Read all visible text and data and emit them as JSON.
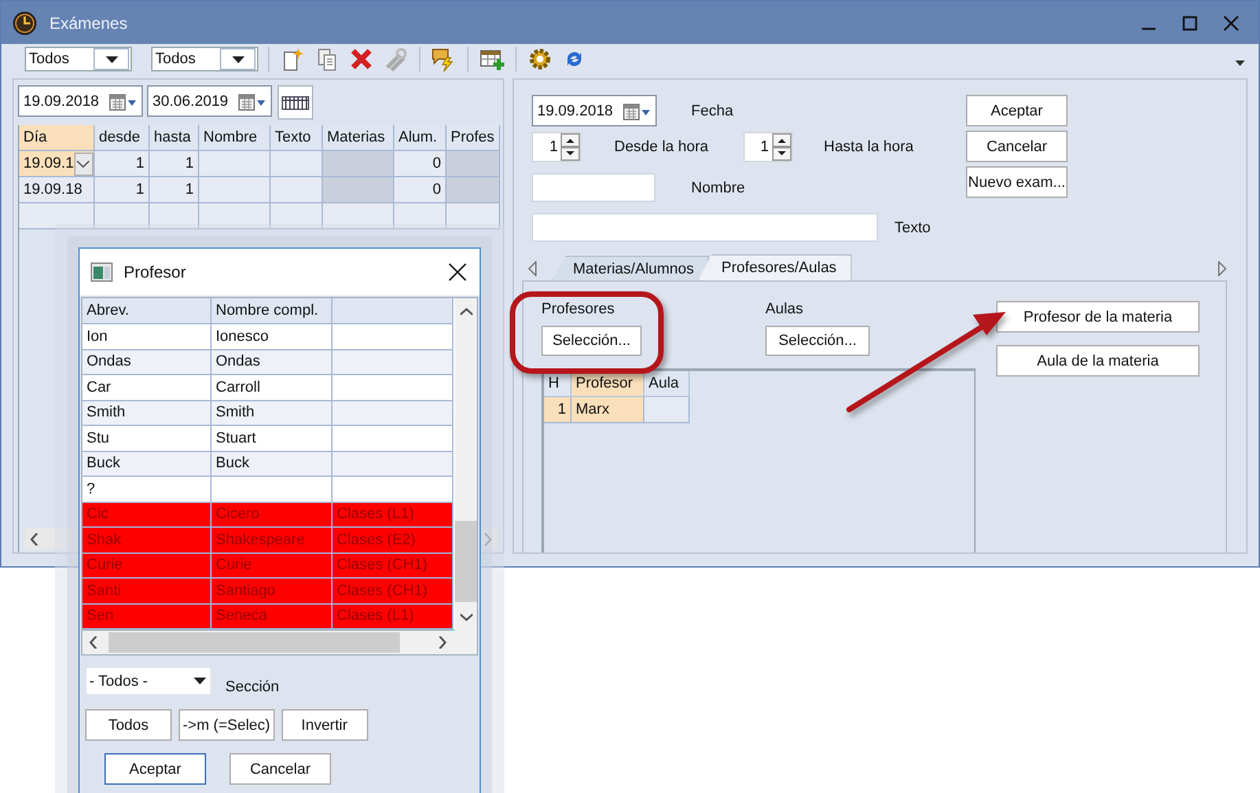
{
  "window": {
    "title": "Exámenes"
  },
  "toolbar": {
    "filters": [
      {
        "value": "Todos"
      },
      {
        "value": "Todos"
      }
    ]
  },
  "left_pane": {
    "date_from": "19.09.2018",
    "date_to": "30.06.2019",
    "table": {
      "columns": [
        {
          "label": "Día",
          "current": true,
          "readonly": false
        },
        {
          "label": "desde",
          "current": false,
          "readonly": false
        },
        {
          "label": "hasta",
          "current": false,
          "readonly": false
        },
        {
          "label": "Nombre",
          "current": false,
          "readonly": false
        },
        {
          "label": "Texto",
          "current": false,
          "readonly": false
        },
        {
          "label": "Materias",
          "current": false,
          "readonly": true
        },
        {
          "label": "Alum.",
          "current": false,
          "readonly": false
        },
        {
          "label": "Profes",
          "current": false,
          "readonly": true
        }
      ],
      "rows": [
        {
          "selected": true,
          "cells": [
            "19.09.1",
            "1",
            "1",
            null,
            null,
            null,
            "0",
            null
          ]
        },
        {
          "selected": false,
          "cells": [
            "19.09.18",
            "1",
            "1",
            null,
            null,
            null,
            "0",
            null
          ]
        }
      ]
    }
  },
  "form": {
    "date": {
      "value": "19.09.2018",
      "label": "Fecha"
    },
    "from_hour": {
      "value": "1",
      "label": "Desde la hora"
    },
    "to_hour": {
      "value": "1",
      "label": "Hasta la hora"
    },
    "name": {
      "label": "Nombre"
    },
    "text": {
      "label": "Texto"
    },
    "buttons": [
      "Aceptar",
      "Cancelar",
      "Nuevo exam..."
    ]
  },
  "tabs": [
    {
      "label": "Materias/Alumnos",
      "selected": false
    },
    {
      "label": "Profesores/Aulas",
      "selected": true
    }
  ],
  "tab_panel": {
    "teachers_label": "Profesores",
    "teachers_button": "Selección...",
    "rooms_label": "Aulas",
    "rooms_button": "Selección...",
    "side_buttons": [
      "Profesor de la materia",
      "Aula de la materia"
    ],
    "table": {
      "columns": [
        {
          "label": "H",
          "current": false
        },
        {
          "label": "Profesor",
          "current": true
        },
        {
          "label": "Aula",
          "current": false
        }
      ],
      "rows": [
        {
          "cells": [
            "1",
            "Marx",
            null
          ]
        }
      ]
    }
  },
  "dialog": {
    "title": "Profesor",
    "table": {
      "columns": [
        "Abrev.",
        "Nombre compl.",
        null
      ],
      "rows": [
        {
          "highlighted": false,
          "cells": [
            "Ion",
            "Ionesco",
            null
          ]
        },
        {
          "highlighted": false,
          "cells": [
            "Ondas",
            "Ondas",
            null
          ]
        },
        {
          "highlighted": false,
          "cells": [
            "Car",
            "Carroll",
            null
          ]
        },
        {
          "highlighted": false,
          "cells": [
            "Smith",
            "Smith",
            null
          ]
        },
        {
          "highlighted": false,
          "cells": [
            "Stu",
            "Stuart",
            null
          ]
        },
        {
          "highlighted": false,
          "cells": [
            "Buck",
            "Buck",
            null
          ]
        },
        {
          "highlighted": false,
          "cells": [
            "?",
            null,
            null
          ]
        },
        {
          "highlighted": true,
          "cells": [
            "Cic",
            "Cicero",
            "Clases (L1)"
          ]
        },
        {
          "highlighted": true,
          "cells": [
            "Shak",
            "Shakespeare",
            "Clases (E2)"
          ]
        },
        {
          "highlighted": true,
          "cells": [
            "Curie",
            "Curie",
            "Clases (CH1)"
          ]
        },
        {
          "highlighted": true,
          "cells": [
            "Santi",
            "Santiago",
            "Clases (CH1)"
          ]
        },
        {
          "highlighted": true,
          "cells": [
            "Sen",
            "Seneca",
            "Clases (L1)"
          ]
        }
      ]
    },
    "section": {
      "value": "- Todos -",
      "label": "Sección"
    },
    "buttons": [
      "Todos",
      "->m (=Selec)",
      "Invertir"
    ],
    "footer_buttons": [
      "Aceptar",
      "Cancelar"
    ]
  }
}
